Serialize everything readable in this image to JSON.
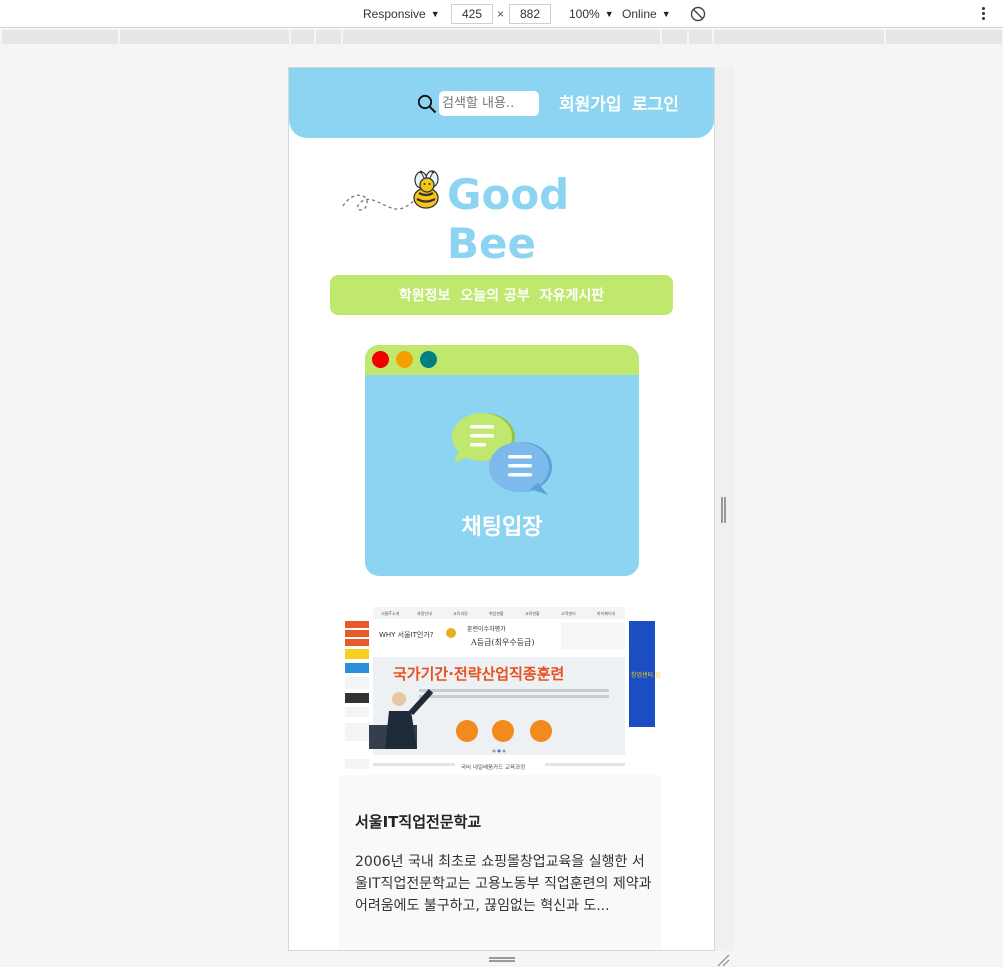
{
  "devtools": {
    "device_mode": "Responsive",
    "width": "425",
    "height": "882",
    "zoom": "100%",
    "network": "Online",
    "dim_separator": "×"
  },
  "header": {
    "search_placeholder": "검색할 내용..",
    "signup_label": "회원가입",
    "login_label": "로그인"
  },
  "logo": {
    "text": "Good Bee"
  },
  "nav": {
    "items": [
      {
        "label": "학원정보"
      },
      {
        "label": "오늘의 공부"
      },
      {
        "label": "자유게시판"
      }
    ]
  },
  "chat": {
    "label": "채팅입장",
    "dot_colors": [
      "#f00000",
      "#f5a000",
      "#00807f"
    ]
  },
  "article": {
    "banner": {
      "menu": [
        "서울IT소개",
        "과정안내",
        "교육과정",
        "취업현황",
        "교육현황",
        "고객센터",
        "마이페이지"
      ],
      "why_text": "WHY 서울IT인가?",
      "rating_text": "훈련이수자평가",
      "grade_text": "A등급(최우수등급)",
      "headline": "국가기간·전략산업직종훈련",
      "badges": [
        "훈련비 100% 전액지원",
        "교재비 무료",
        "훈련장려금 매월 지급"
      ],
      "footer": "국비 내일배움카드 교육과정",
      "side_text": "창업센터 입점"
    },
    "title": "서울IT직업전문학교",
    "body": "2006년 국내 최초로 쇼핑몰창업교육을 실행한 서울IT직업전문학교는 고용노동부 직업훈련의 제약과 어려움에도 불구하고, 끊임없는 혁신과 도..."
  },
  "colors": {
    "header_blue": "#8cd4f1",
    "nav_green": "#c0e86f"
  }
}
